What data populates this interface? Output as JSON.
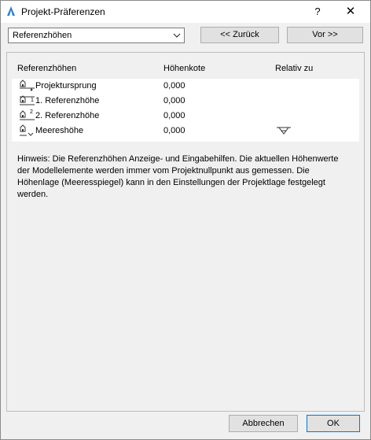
{
  "window": {
    "title": "Projekt-Präferenzen",
    "help": "?",
    "close": "✕"
  },
  "nav": {
    "dropdown_value": "Referenzhöhen",
    "back_label": "<< Zurück",
    "next_label": "Vor >>"
  },
  "table": {
    "headers": [
      "Referenzhöhen",
      "Höhenkote",
      "Relativ zu"
    ],
    "rows": [
      {
        "name": "Projektursprung",
        "kote": "0,000",
        "icon": "project-origin-icon"
      },
      {
        "name": "1. Referenzhöhe",
        "kote": "0,000",
        "icon": "reference-level-1-icon"
      },
      {
        "name": "2. Referenzhöhe",
        "kote": "0,000",
        "icon": "reference-level-2-icon"
      },
      {
        "name": "Meereshöhe",
        "kote": "0,000",
        "icon": "sea-level-icon",
        "relative_icon": "sea-level-triangle-icon"
      }
    ]
  },
  "note": "Hinweis: Die Referenzhöhen Anzeige- und Eingabehilfen. Die aktuellen Höhenwerte der Modellelemente werden immer vom Projektnullpunkt aus gemessen. Die Höhenlage (Meeresspiegel) kann in den Einstellungen der Projektlage festgelegt werden.",
  "footer": {
    "cancel_label": "Abbrechen",
    "ok_label": "OK"
  },
  "colors": {
    "dialog_bg": "#f0f0f0",
    "ok_border": "#0078d7"
  }
}
